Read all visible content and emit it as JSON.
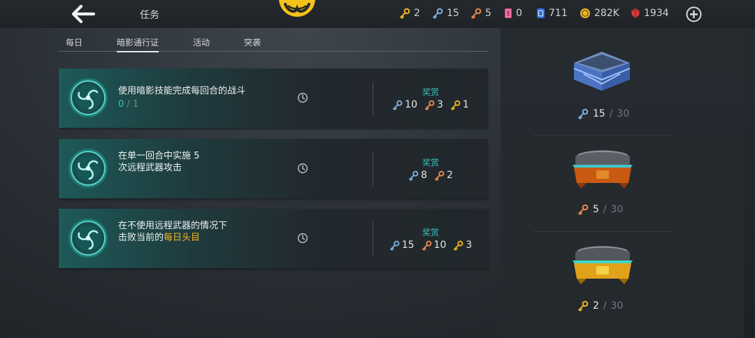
{
  "header": {
    "title": "任务",
    "resources": [
      {
        "icon": "gold-key-icon",
        "value": "2",
        "color": "#f2b524"
      },
      {
        "icon": "blue-key-icon",
        "value": "15",
        "color": "#7fb2e0"
      },
      {
        "icon": "bronze-key-icon",
        "value": "5",
        "color": "#ee8a4a"
      },
      {
        "icon": "ticket-icon",
        "value": "0",
        "color": "#d4407c"
      },
      {
        "icon": "gem-card-icon",
        "value": "711",
        "color": "#4d8ff0"
      },
      {
        "icon": "coin-icon",
        "value": "282K",
        "color": "#e8b52c"
      },
      {
        "icon": "ruby-icon",
        "value": "1934",
        "color": "#d23a3a"
      }
    ]
  },
  "tabs": [
    {
      "label": "每日"
    },
    {
      "label": "暗影通行证"
    },
    {
      "label": "活动"
    },
    {
      "label": "突袭"
    }
  ],
  "missions": [
    {
      "line1": "使用暗影技能完成每回合的战斗",
      "progress_current": "0",
      "progress_sep": "/",
      "progress_max": "1",
      "reward_label": "奖赏",
      "rewards": [
        {
          "icon": "blue-key-icon",
          "value": "10"
        },
        {
          "icon": "bronze-key-icon",
          "value": "3"
        },
        {
          "icon": "gold-key-icon",
          "value": "1"
        }
      ]
    },
    {
      "line1": "在单一回合中实施 5",
      "line2": "次远程武器攻击",
      "reward_label": "奖赏",
      "rewards": [
        {
          "icon": "blue-key-icon",
          "value": "8"
        },
        {
          "icon": "bronze-key-icon",
          "value": "2"
        }
      ]
    },
    {
      "line1": "在不使用远程武器的情况下",
      "line2_prefix": "击败当前的",
      "line2_highlight": "每日头目",
      "reward_label": "奖赏",
      "rewards": [
        {
          "icon": "blue-key-icon",
          "value": "15"
        },
        {
          "icon": "bronze-key-icon",
          "value": "10"
        },
        {
          "icon": "gold-key-icon",
          "value": "3"
        }
      ]
    }
  ],
  "chests": [
    {
      "name": "blue-chest",
      "count": "15",
      "sep": "/",
      "max": "30"
    },
    {
      "name": "bronze-chest",
      "count": "5",
      "sep": "/",
      "max": "30"
    },
    {
      "name": "gold-chest",
      "count": "2",
      "sep": "/",
      "max": "30"
    }
  ]
}
